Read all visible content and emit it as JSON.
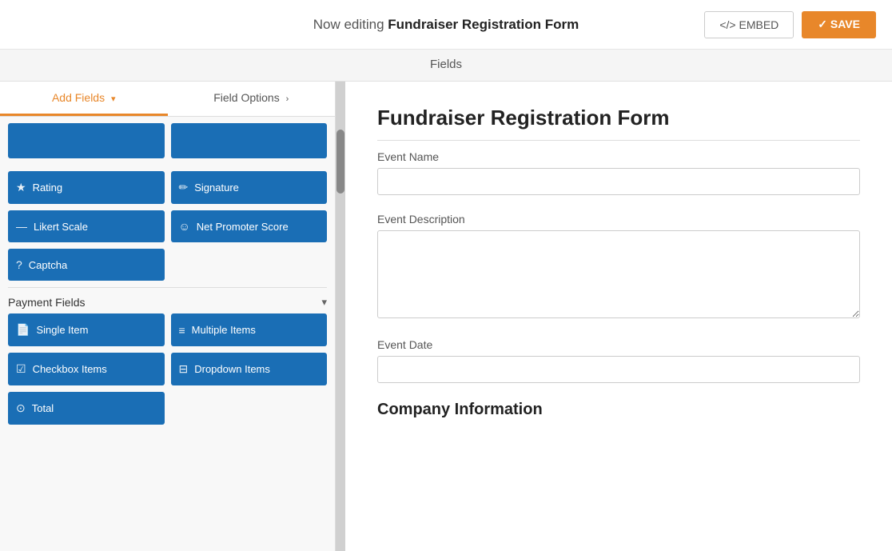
{
  "header": {
    "editing_label": "Now editing ",
    "form_name": "Fundraiser Registration Form",
    "embed_label": "</>  EMBED",
    "save_label": "✓  SAVE"
  },
  "subheader": {
    "label": "Fields"
  },
  "left_panel": {
    "tab_add_fields": "Add Fields",
    "tab_field_options": "Field Options",
    "tab_add_chevron": "▾",
    "tab_options_chevron": "›",
    "partial_buttons": [
      {
        "label": ""
      },
      {
        "label": ""
      }
    ],
    "field_buttons": [
      {
        "id": "rating",
        "icon": "★",
        "label": "Rating"
      },
      {
        "id": "signature",
        "icon": "✏",
        "label": "Signature"
      },
      {
        "id": "likert-scale",
        "icon": "—",
        "label": "Likert Scale"
      },
      {
        "id": "net-promoter-score",
        "icon": "☺",
        "label": "Net Promoter Score"
      },
      {
        "id": "captcha",
        "icon": "?",
        "label": "Captcha"
      }
    ],
    "payment_section": {
      "title": "Payment Fields",
      "chevron": "▾",
      "buttons": [
        {
          "id": "single-item",
          "icon": "📄",
          "label": "Single Item"
        },
        {
          "id": "multiple-items",
          "icon": "≡",
          "label": "Multiple Items"
        },
        {
          "id": "checkbox-items",
          "icon": "☑",
          "label": "Checkbox Items"
        },
        {
          "id": "dropdown-items",
          "icon": "⊟",
          "label": "Dropdown Items"
        },
        {
          "id": "total",
          "icon": "⊙",
          "label": "Total"
        }
      ]
    }
  },
  "form_preview": {
    "title": "Fundraiser Registration Form",
    "fields": [
      {
        "id": "event-name",
        "label": "Event Name",
        "type": "input"
      },
      {
        "id": "event-description",
        "label": "Event Description",
        "type": "textarea"
      },
      {
        "id": "event-date",
        "label": "Event Date",
        "type": "input"
      }
    ],
    "section": "Company Information"
  }
}
